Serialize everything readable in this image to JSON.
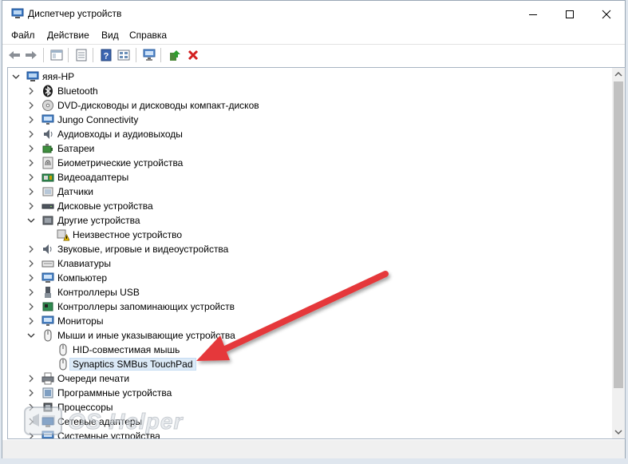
{
  "window": {
    "title": "Диспетчер устройств"
  },
  "menu": [
    "Файл",
    "Действие",
    "Вид",
    "Справка"
  ],
  "tree": {
    "root": "яяя-HP",
    "rows": [
      {
        "label": "Bluetooth",
        "icon": "bluetooth-icon",
        "toggle": "collapsed",
        "level": 1
      },
      {
        "label": "DVD-дисководы и дисководы компакт-дисков",
        "icon": "dvd-drive-icon",
        "toggle": "collapsed",
        "level": 1
      },
      {
        "label": "Jungo Connectivity",
        "icon": "monitor-icon",
        "toggle": "collapsed",
        "level": 1
      },
      {
        "label": "Аудиовходы и аудиовыходы",
        "icon": "audio-icon",
        "toggle": "collapsed",
        "level": 1
      },
      {
        "label": "Батареи",
        "icon": "battery-icon",
        "toggle": "collapsed",
        "level": 1
      },
      {
        "label": "Биометрические устройства",
        "icon": "fingerprint-icon",
        "toggle": "collapsed",
        "level": 1
      },
      {
        "label": "Видеоадаптеры",
        "icon": "display-adapter-icon",
        "toggle": "collapsed",
        "level": 1
      },
      {
        "label": "Датчики",
        "icon": "sensor-icon",
        "toggle": "collapsed",
        "level": 1
      },
      {
        "label": "Дисковые устройства",
        "icon": "disk-drive-icon",
        "toggle": "collapsed",
        "level": 1
      },
      {
        "label": "Другие устройства",
        "icon": "other-devices-icon",
        "toggle": "expanded",
        "level": 1
      },
      {
        "label": "Неизвестное устройство",
        "icon": "unknown-device-warning-icon",
        "toggle": "none",
        "level": 2
      },
      {
        "label": "Звуковые, игровые и видеоустройства",
        "icon": "speaker-icon",
        "toggle": "collapsed",
        "level": 1
      },
      {
        "label": "Клавиатуры",
        "icon": "keyboard-icon",
        "toggle": "collapsed",
        "level": 1
      },
      {
        "label": "Компьютер",
        "icon": "computer-icon",
        "toggle": "collapsed",
        "level": 1
      },
      {
        "label": "Контроллеры USB",
        "icon": "usb-icon",
        "toggle": "collapsed",
        "level": 1
      },
      {
        "label": "Контроллеры запоминающих устройств",
        "icon": "storage-controller-icon",
        "toggle": "collapsed",
        "level": 1
      },
      {
        "label": "Мониторы",
        "icon": "monitor-icon",
        "toggle": "collapsed",
        "level": 1
      },
      {
        "label": "Мыши и иные указывающие устройства",
        "icon": "mouse-icon",
        "toggle": "expanded",
        "level": 1
      },
      {
        "label": "HID-совместимая мышь",
        "icon": "mouse-icon",
        "toggle": "none",
        "level": 2
      },
      {
        "label": "Synaptics SMBus TouchPad",
        "icon": "mouse-icon",
        "toggle": "none",
        "level": 2,
        "selected": true
      },
      {
        "label": "Очереди печати",
        "icon": "printer-icon",
        "toggle": "collapsed",
        "level": 1
      },
      {
        "label": "Программные устройства",
        "icon": "software-device-icon",
        "toggle": "collapsed",
        "level": 1
      },
      {
        "label": "Процессоры",
        "icon": "processor-icon",
        "toggle": "collapsed",
        "level": 1
      },
      {
        "label": "Сетевые адаптеры",
        "icon": "network-adapter-icon",
        "toggle": "collapsed",
        "level": 1
      },
      {
        "label": "Системные устройства",
        "icon": "system-devices-icon",
        "toggle": "collapsed",
        "level": 1
      }
    ]
  },
  "watermark": {
    "text": "OS Helper"
  },
  "colors": {
    "arrow": "#e5393a",
    "selection": "#dceaf7",
    "accent": "#1e73be"
  }
}
